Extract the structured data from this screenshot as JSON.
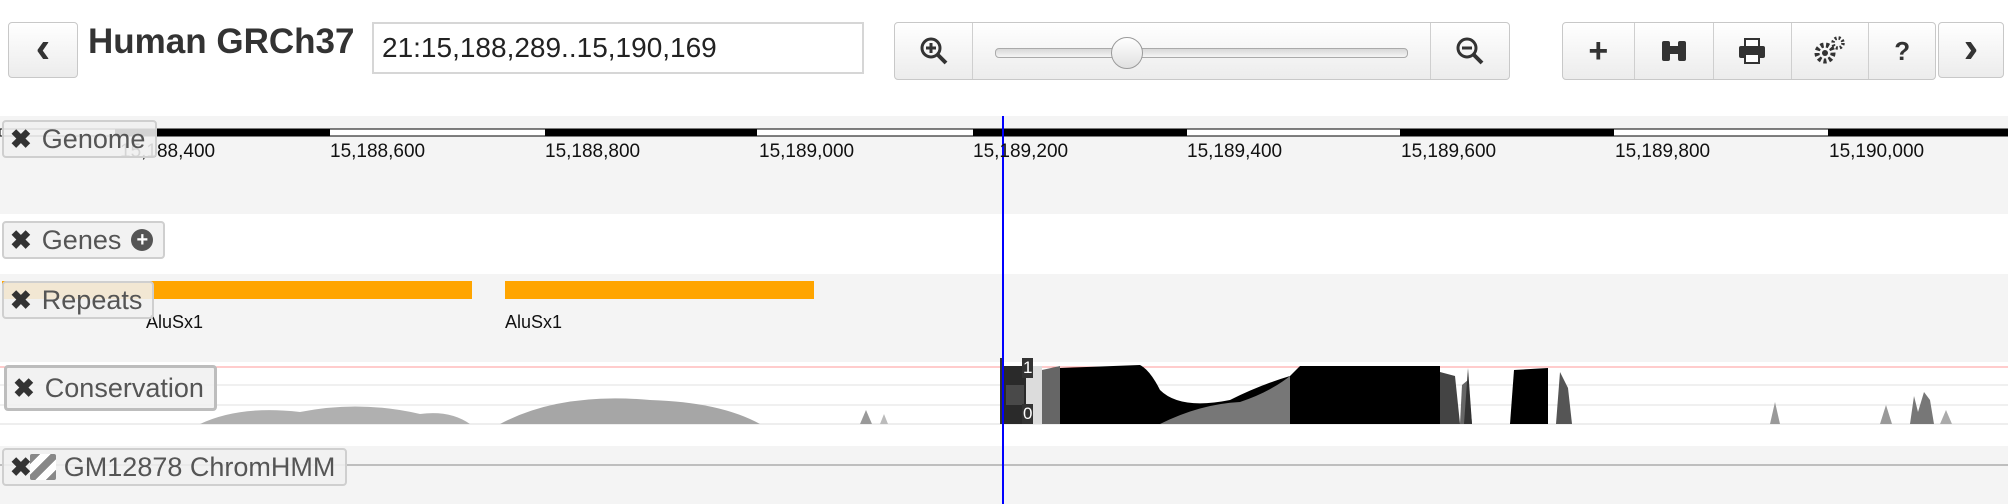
{
  "nav": {
    "back_label": "‹",
    "forward_label": "›"
  },
  "assembly": {
    "name": "Human GRCh37"
  },
  "locus": {
    "value": "21:15,188,289..15,190,169"
  },
  "zoom": {
    "in_icon": "zoom-in-icon",
    "out_icon": "zoom-out-icon",
    "slider_level": 0.33
  },
  "toolbar": {
    "items": [
      "add-track-icon",
      "search-icon",
      "print-icon",
      "settings-icon",
      "help-icon"
    ],
    "help_label": "?"
  },
  "ruler": {
    "ticks": [
      "15,188,400",
      "15,188,600",
      "15,188,800",
      "15,189,000",
      "15,189,200",
      "15,189,400",
      "15,189,600",
      "15,189,800",
      "15,190,000"
    ]
  },
  "tracks": [
    {
      "name": "Genome"
    },
    {
      "name": "Genes"
    },
    {
      "name": "Repeats"
    },
    {
      "name": "Conservation"
    },
    {
      "name": "GM12878 ChromHMM"
    }
  ],
  "repeats": {
    "features": [
      {
        "label": "AluSx1"
      },
      {
        "label": "AluSx1"
      }
    ]
  },
  "conservation": {
    "max_label": "1",
    "min_label": "0"
  },
  "colors": {
    "repeat": "#ffa500",
    "cursor": "#0000ff",
    "band": "#f4f4f4",
    "conservation_ref": "#ff9999"
  }
}
